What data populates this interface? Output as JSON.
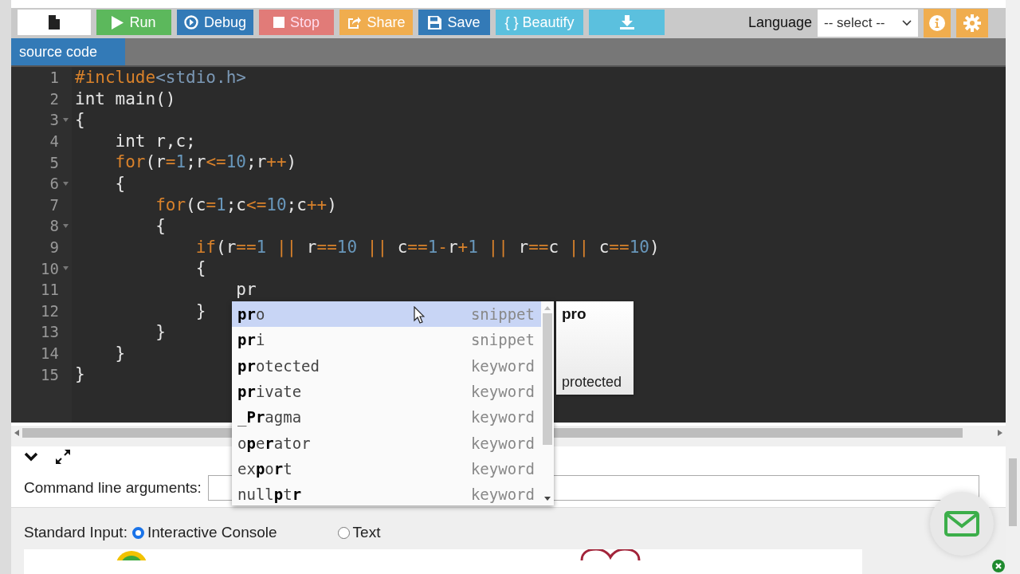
{
  "toolbar": {
    "buttons": [
      {
        "kind": "file"
      },
      {
        "kind": "run",
        "label": "Run"
      },
      {
        "kind": "debug",
        "label": "Debug"
      },
      {
        "kind": "stop",
        "label": "Stop"
      },
      {
        "kind": "share",
        "label": "Share"
      },
      {
        "kind": "save",
        "label": "Save"
      },
      {
        "kind": "beautify",
        "label": "{ } Beautify"
      },
      {
        "kind": "download"
      }
    ],
    "language_label": "Language",
    "language_select": "-- select --"
  },
  "tabs": [
    {
      "label": "source code",
      "selected": true
    }
  ],
  "editor": {
    "lines": [
      {
        "number": "1",
        "foldable": false,
        "tokens": [
          {
            "t": "#include",
            "kind": "keyword"
          },
          {
            "t": "<stdio.h>",
            "kind": "string"
          }
        ]
      },
      {
        "number": "2",
        "foldable": false,
        "tokens": [
          {
            "t": "int main()",
            "kind": "plain"
          }
        ]
      },
      {
        "number": "3",
        "foldable": true,
        "tokens": [
          {
            "t": "{",
            "kind": "plain"
          }
        ]
      },
      {
        "number": "4",
        "foldable": false,
        "tokens": [
          {
            "t": "    int r,c;",
            "kind": "plain"
          }
        ]
      },
      {
        "number": "5",
        "foldable": false,
        "tokens": [
          {
            "t": "    for",
            "kind": "keyword"
          },
          {
            "t": "(r",
            "kind": "plain"
          },
          {
            "t": "=",
            "kind": "keyword"
          },
          {
            "t": "1",
            "kind": "number"
          },
          {
            "t": ";r",
            "kind": "plain"
          },
          {
            "t": "<=",
            "kind": "keyword"
          },
          {
            "t": "10",
            "kind": "number"
          },
          {
            "t": ";r",
            "kind": "plain"
          },
          {
            "t": "++",
            "kind": "keyword"
          },
          {
            "t": ")",
            "kind": "plain"
          }
        ]
      },
      {
        "number": "6",
        "foldable": true,
        "tokens": [
          {
            "t": "    {",
            "kind": "plain"
          }
        ]
      },
      {
        "number": "7",
        "foldable": false,
        "tokens": [
          {
            "t": "        for",
            "kind": "keyword"
          },
          {
            "t": "(c",
            "kind": "plain"
          },
          {
            "t": "=",
            "kind": "keyword"
          },
          {
            "t": "1",
            "kind": "number"
          },
          {
            "t": ";c",
            "kind": "plain"
          },
          {
            "t": "<=",
            "kind": "keyword"
          },
          {
            "t": "10",
            "kind": "number"
          },
          {
            "t": ";c",
            "kind": "plain"
          },
          {
            "t": "++",
            "kind": "keyword"
          },
          {
            "t": ")",
            "kind": "plain"
          }
        ]
      },
      {
        "number": "8",
        "foldable": true,
        "tokens": [
          {
            "t": "        {",
            "kind": "plain"
          }
        ]
      },
      {
        "number": "9",
        "foldable": false,
        "tokens": [
          {
            "t": "            if",
            "kind": "keyword"
          },
          {
            "t": "(r",
            "kind": "plain"
          },
          {
            "t": "==",
            "kind": "keyword"
          },
          {
            "t": "1",
            "kind": "number"
          },
          {
            "t": " || ",
            "kind": "keyword"
          },
          {
            "t": "r",
            "kind": "plain"
          },
          {
            "t": "==",
            "kind": "keyword"
          },
          {
            "t": "10",
            "kind": "number"
          },
          {
            "t": " || ",
            "kind": "keyword"
          },
          {
            "t": "c",
            "kind": "plain"
          },
          {
            "t": "==",
            "kind": "keyword"
          },
          {
            "t": "1",
            "kind": "number"
          },
          {
            "t": "-",
            "kind": "keyword"
          },
          {
            "t": "r",
            "kind": "plain"
          },
          {
            "t": "+",
            "kind": "keyword"
          },
          {
            "t": "1",
            "kind": "number"
          },
          {
            "t": " || ",
            "kind": "keyword"
          },
          {
            "t": "r",
            "kind": "plain"
          },
          {
            "t": "==",
            "kind": "keyword"
          },
          {
            "t": "c",
            "kind": "plain"
          },
          {
            "t": " || ",
            "kind": "keyword"
          },
          {
            "t": "c",
            "kind": "plain"
          },
          {
            "t": "==",
            "kind": "keyword"
          },
          {
            "t": "10",
            "kind": "number"
          },
          {
            "t": ")",
            "kind": "plain"
          }
        ]
      },
      {
        "number": "10",
        "foldable": true,
        "tokens": [
          {
            "t": "            {",
            "kind": "plain"
          }
        ]
      },
      {
        "number": "11",
        "foldable": false,
        "tokens": [
          {
            "t": "                pr",
            "kind": "plain"
          }
        ]
      },
      {
        "number": "12",
        "foldable": false,
        "tokens": [
          {
            "t": "            }",
            "kind": "plain"
          }
        ]
      },
      {
        "number": "13",
        "foldable": false,
        "tokens": [
          {
            "t": "        }",
            "kind": "plain"
          }
        ]
      },
      {
        "number": "14",
        "foldable": false,
        "tokens": [
          {
            "t": "    }",
            "kind": "plain"
          }
        ]
      },
      {
        "number": "15",
        "foldable": false,
        "tokens": [
          {
            "t": "}",
            "kind": "plain"
          }
        ]
      }
    ]
  },
  "autocomplete": {
    "items": [
      {
        "label": "**pr**o",
        "type": "snippet",
        "selected": true
      },
      {
        "label": "**pr**i",
        "type": "snippet",
        "selected": false
      },
      {
        "label": "**pr**otected",
        "type": "keyword",
        "selected": false
      },
      {
        "label": "**pr**ivate",
        "type": "keyword",
        "selected": false
      },
      {
        "label": "_**Pr**agma",
        "type": "keyword",
        "selected": false
      },
      {
        "label": "o**p**e**r**ator",
        "type": "keyword",
        "selected": false
      },
      {
        "label": "ex**p**o**r**t",
        "type": "keyword",
        "selected": false
      },
      {
        "label": "null**p**t**r**",
        "type": "keyword",
        "selected": false
      }
    ],
    "doc": {
      "title": "pro",
      "body": "protected"
    }
  },
  "io_panel": {
    "command_line_label": "Command line arguments:",
    "standard_input_label": "Standard Input:",
    "options": [
      {
        "label": "Interactive Console",
        "selected": true
      },
      {
        "label": "Text",
        "selected": false
      }
    ]
  }
}
